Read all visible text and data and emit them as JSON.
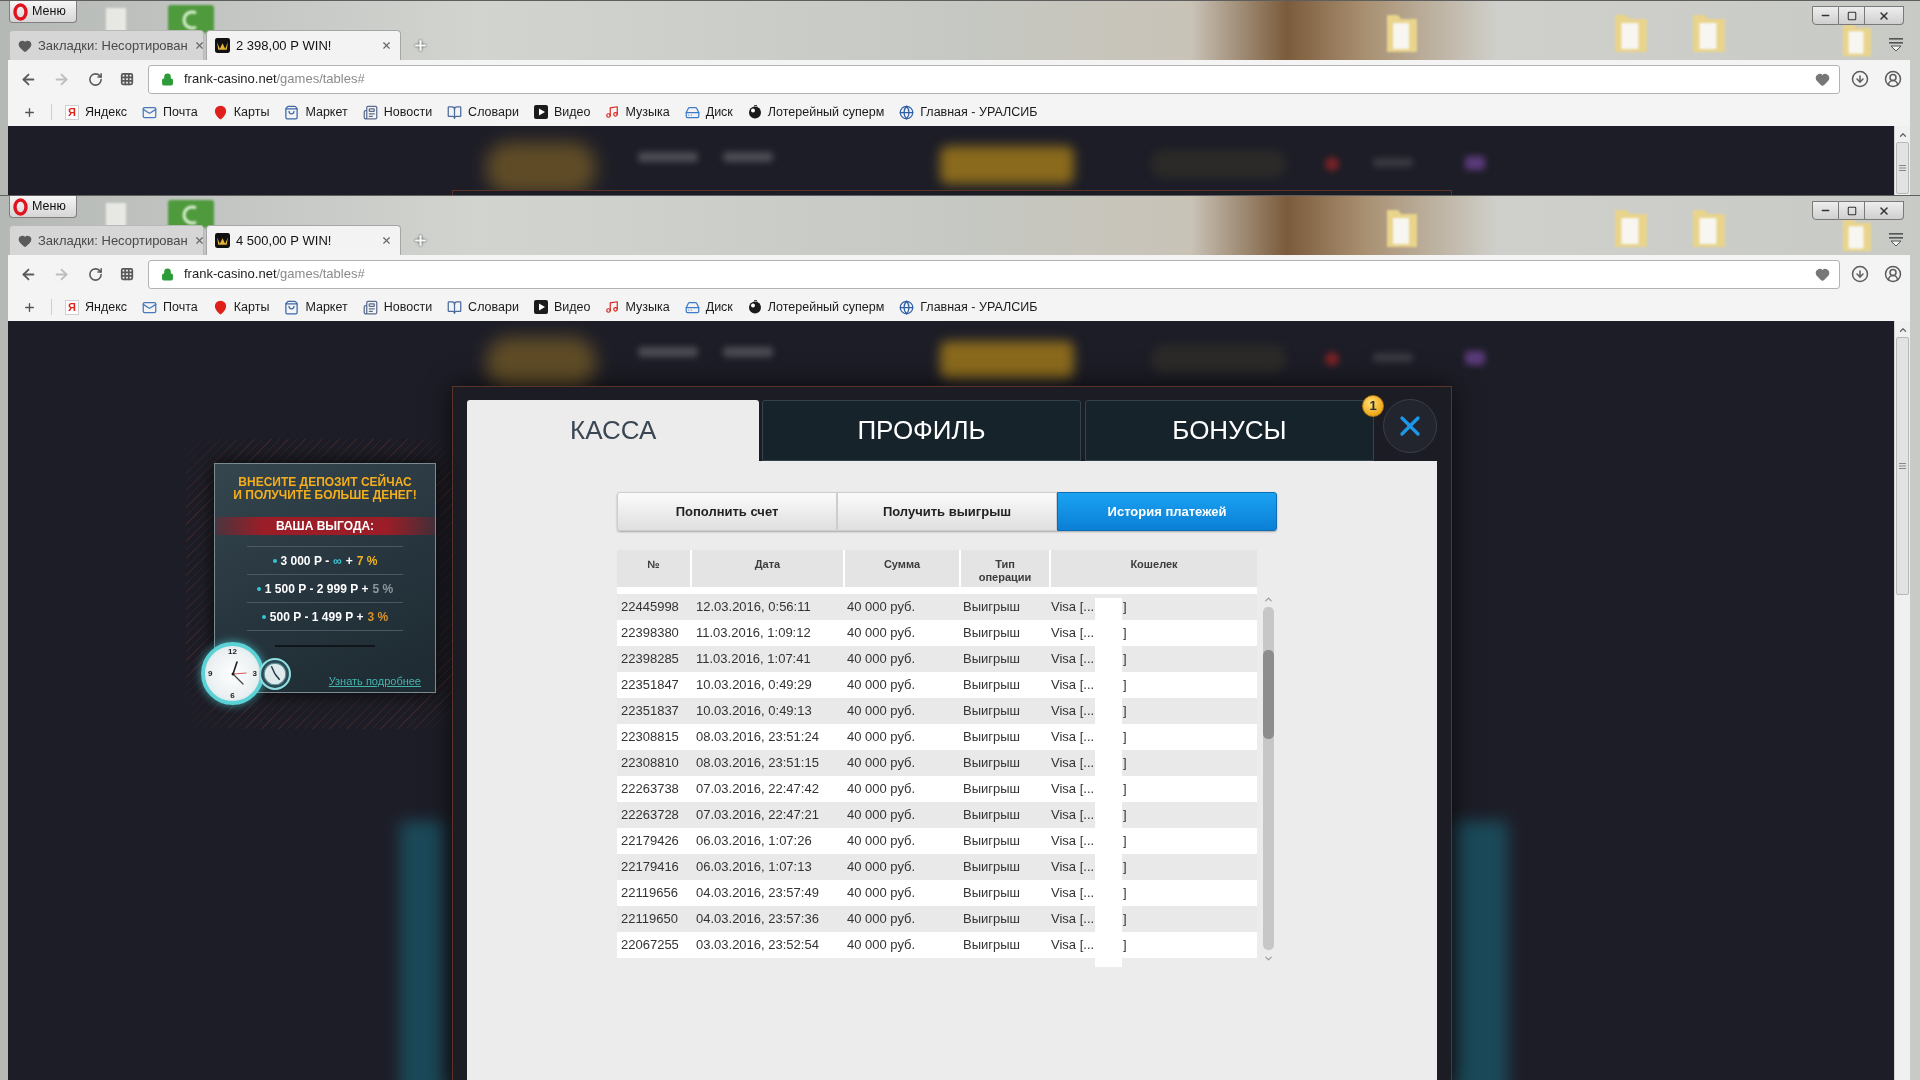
{
  "windows": [
    {
      "kind": "background",
      "menu_label": "Меню",
      "tabs": [
        {
          "title": "Закладки: Несортирован",
          "kind": "bookmarks",
          "selected": false
        },
        {
          "title": "2 398,00 Р WIN!",
          "kind": "site",
          "selected": true
        }
      ],
      "forward_disabled": true,
      "address": {
        "host": "frank-casino.net",
        "path": "/games/tables#"
      },
      "bookmarks": [
        {
          "label": "Яндекс",
          "kind": "letter",
          "glyph": "Я"
        },
        {
          "label": "Почта",
          "kind": "mail"
        },
        {
          "label": "Карты",
          "kind": "pin"
        },
        {
          "label": "Маркет",
          "kind": "market"
        },
        {
          "label": "Новости",
          "kind": "news"
        },
        {
          "label": "Словари",
          "kind": "dictionary"
        },
        {
          "label": "Видео",
          "kind": "video"
        },
        {
          "label": "Музыка",
          "kind": "music"
        },
        {
          "label": "Диск",
          "kind": "disk"
        },
        {
          "label": "Лотерейный суперм",
          "kind": "lottery"
        },
        {
          "label": "Главная - УРАЛСИБ",
          "kind": "globe"
        }
      ]
    },
    {
      "kind": "front",
      "menu_label": "Меню",
      "tabs": [
        {
          "title": "Закладки: Несортирован",
          "kind": "bookmarks",
          "selected": false
        },
        {
          "title": "4 500,00 Р WIN!",
          "kind": "site",
          "selected": true
        }
      ],
      "forward_disabled": true,
      "address": {
        "host": "frank-casino.net",
        "path": "/games/tables#"
      },
      "bookmarks": [
        {
          "label": "Яндекс",
          "kind": "letter",
          "glyph": "Я"
        },
        {
          "label": "Почта",
          "kind": "mail"
        },
        {
          "label": "Карты",
          "kind": "pin"
        },
        {
          "label": "Маркет",
          "kind": "market"
        },
        {
          "label": "Новости",
          "kind": "news"
        },
        {
          "label": "Словари",
          "kind": "dictionary"
        },
        {
          "label": "Видео",
          "kind": "video"
        },
        {
          "label": "Музыка",
          "kind": "music"
        },
        {
          "label": "Диск",
          "kind": "disk"
        },
        {
          "label": "Лотерейный суперм",
          "kind": "lottery"
        },
        {
          "label": "Главная - УРАЛСИБ",
          "kind": "globe"
        }
      ]
    }
  ],
  "modal": {
    "tabs": [
      {
        "label": "КАССА",
        "selected": true
      },
      {
        "label": "ПРОФИЛЬ",
        "selected": false
      },
      {
        "label": "БОНУСЫ",
        "selected": false,
        "badge": "1"
      }
    ],
    "subtabs": [
      {
        "label": "Пополнить счет",
        "selected": false
      },
      {
        "label": "Получить выигрыш",
        "selected": false
      },
      {
        "label": "История платежей",
        "selected": true
      }
    ],
    "table": {
      "columns": [
        "№",
        "Дата",
        "Сумма",
        "Тип\nоперации",
        "Кошелек"
      ],
      "rows": [
        {
          "number": "22445998",
          "date": "12.03.2016, 0:56:11",
          "amount": "40 000 руб.",
          "type": "Выигрыш",
          "wallet": "Visa [...",
          "wallet_end": "]"
        },
        {
          "number": "22398380",
          "date": "11.03.2016, 1:09:12",
          "amount": "40 000 руб.",
          "type": "Выигрыш",
          "wallet": "Visa [...",
          "wallet_end": "]"
        },
        {
          "number": "22398285",
          "date": "11.03.2016, 1:07:41",
          "amount": "40 000 руб.",
          "type": "Выигрыш",
          "wallet": "Visa [...",
          "wallet_end": "]"
        },
        {
          "number": "22351847",
          "date": "10.03.2016, 0:49:29",
          "amount": "40 000 руб.",
          "type": "Выигрыш",
          "wallet": "Visa [...",
          "wallet_end": "]"
        },
        {
          "number": "22351837",
          "date": "10.03.2016, 0:49:13",
          "amount": "40 000 руб.",
          "type": "Выигрыш",
          "wallet": "Visa [...",
          "wallet_end": "]"
        },
        {
          "number": "22308815",
          "date": "08.03.2016, 23:51:24",
          "amount": "40 000 руб.",
          "type": "Выигрыш",
          "wallet": "Visa [...",
          "wallet_end": "]"
        },
        {
          "number": "22308810",
          "date": "08.03.2016, 23:51:15",
          "amount": "40 000 руб.",
          "type": "Выигрыш",
          "wallet": "Visa [...",
          "wallet_end": "]"
        },
        {
          "number": "22263738",
          "date": "07.03.2016, 22:47:42",
          "amount": "40 000 руб.",
          "type": "Выигрыш",
          "wallet": "Visa [...",
          "wallet_end": "]"
        },
        {
          "number": "22263728",
          "date": "07.03.2016, 22:47:21",
          "amount": "40 000 руб.",
          "type": "Выигрыш",
          "wallet": "Visa [...",
          "wallet_end": "]"
        },
        {
          "number": "22179426",
          "date": "06.03.2016, 1:07:26",
          "amount": "40 000 руб.",
          "type": "Выигрыш",
          "wallet": "Visa [...",
          "wallet_end": "]"
        },
        {
          "number": "22179416",
          "date": "06.03.2016, 1:07:13",
          "amount": "40 000 руб.",
          "type": "Выигрыш",
          "wallet": "Visa [...",
          "wallet_end": "]"
        },
        {
          "number": "22119656",
          "date": "04.03.2016, 23:57:49",
          "amount": "40 000 руб.",
          "type": "Выигрыш",
          "wallet": "Visa [...",
          "wallet_end": "]"
        },
        {
          "number": "22119650",
          "date": "04.03.2016, 23:57:36",
          "amount": "40 000 руб.",
          "type": "Выигрыш",
          "wallet": "Visa [...",
          "wallet_end": "]"
        },
        {
          "number": "22067255",
          "date": "03.03.2016, 23:52:54",
          "amount": "40 000 руб.",
          "type": "Выигрыш",
          "wallet": "Visa [...",
          "wallet_end": "]"
        }
      ]
    }
  },
  "promo": {
    "title": "ВНЕСИТЕ ДЕПОЗИТ СЕЙЧАС\nИ ПОЛУЧИТЕ БОЛЬШЕ ДЕНЕГ!",
    "banner": "ВАША ВЫГОДА:",
    "tiers": [
      {
        "range": [
          {
            "text": "3 000 Р -",
            "kind": "plain"
          },
          {
            "text": "∞",
            "kind": "accent"
          },
          {
            "text": "+",
            "kind": "plain"
          }
        ],
        "bonus": "7 %",
        "color": "#f4b31f"
      },
      {
        "range": [
          {
            "text": "1 500 Р - 2 999 Р +",
            "kind": "plain"
          }
        ],
        "bonus": "5 %",
        "color": "#8c979c"
      },
      {
        "range": [
          {
            "text": "500 Р - 1 499 Р +",
            "kind": "plain"
          }
        ],
        "bonus": "3 %",
        "color": "#d8912b"
      }
    ],
    "clock_numerals": [
      "12",
      "3",
      "6",
      "9"
    ],
    "link": "Узнать подробнее"
  }
}
